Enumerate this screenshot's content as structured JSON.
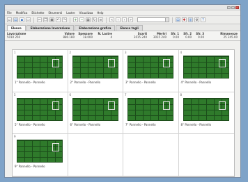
{
  "menu": [
    "File",
    "Modifica",
    "Etichette",
    "Strumenti",
    "Lastre",
    "Visualizza",
    "Help"
  ],
  "toolbar": {
    "left_icons": [
      "new-icon",
      "open-icon",
      "save-icon",
      "print-icon",
      "cut-icon",
      "copy-icon",
      "paste-icon",
      "undo-icon",
      "redo-icon",
      "zoom-in-icon",
      "zoom-out-icon",
      "grid-icon",
      "refresh-icon",
      "list-icon",
      "first-icon",
      "prev-icon",
      "next-icon",
      "last-icon"
    ],
    "combo_value": "",
    "right_icons": [
      "sheet-icon",
      "optimize-icon",
      "stats-icon",
      "tools-icon",
      "info-icon"
    ]
  },
  "tabs": [
    "Elenco",
    "Elaborazione lavorazione",
    "Elaborazione grafica",
    "Elenco tagli"
  ],
  "info": {
    "left_label": "Lavorazione",
    "left_value": "5010 250",
    "fields": [
      {
        "label": "Valore",
        "value": "880.180"
      },
      {
        "label": "Spessore",
        "value": "18.000"
      },
      {
        "label": "N. Lastre",
        "value": "4"
      },
      {
        "label": "Scarti",
        "value": "3015 240"
      },
      {
        "label": "Mertri",
        "value": "3015 240"
      },
      {
        "label": "Sfr. 1",
        "value": "0.00"
      },
      {
        "label": "Sfr. 2",
        "value": "0.00"
      },
      {
        "label": "Sfr. 3",
        "value": "0.00"
      },
      {
        "label": "Rimanenze",
        "value": "25 245.00"
      }
    ]
  },
  "thumbnails": [
    {
      "num": "1",
      "caption": "1° Pannello - Pannello"
    },
    {
      "num": "2",
      "caption": "2° Pannello - Pannello"
    },
    {
      "num": "3",
      "caption": "3° Pannello - Pannello"
    },
    {
      "num": "4",
      "caption": "4° Pannello - Pannello"
    },
    {
      "num": "5",
      "caption": "5° Pannello - Pannello"
    },
    {
      "num": "6",
      "caption": "6° Pannello - Pannello"
    },
    {
      "num": "7",
      "caption": "7° Pannello - Pannello"
    },
    {
      "num": "8",
      "caption": "8° Pannello - Pannello"
    },
    {
      "num": "9",
      "caption": "9° Pannello - Pannello"
    },
    {
      "num": "",
      "caption": ""
    },
    {
      "num": "",
      "caption": ""
    },
    {
      "num": "",
      "caption": ""
    }
  ]
}
